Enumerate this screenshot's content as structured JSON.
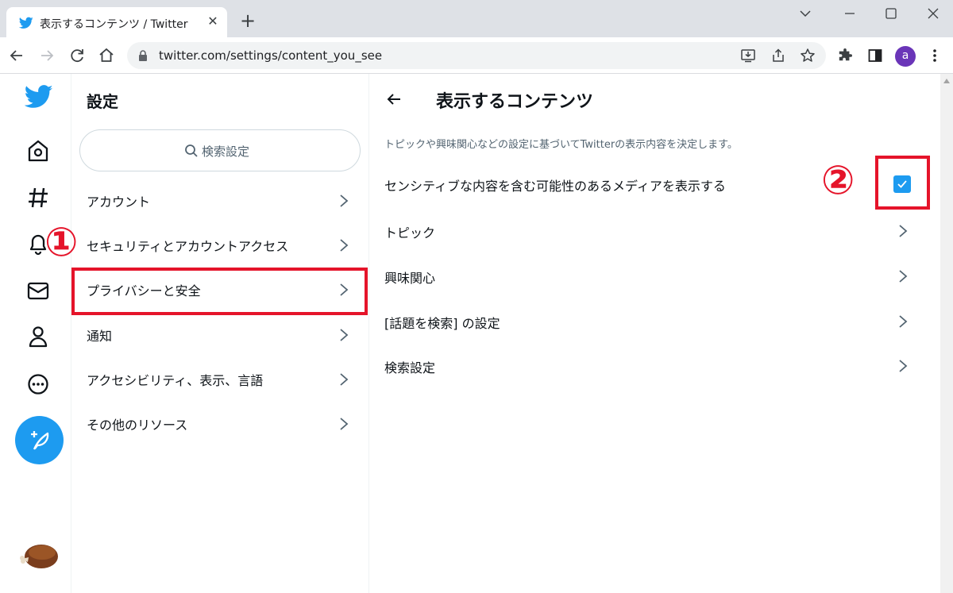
{
  "browser": {
    "tab_title": "表示するコンテンツ / Twitter",
    "tab_close": "✕",
    "new_tab": "+",
    "url": "twitter.com/settings/content_you_see",
    "profile_initial": "a"
  },
  "settings": {
    "title": "設定",
    "search_placeholder": "検索設定",
    "menu": [
      {
        "label": "アカウント"
      },
      {
        "label": "セキュリティとアカウントアクセス"
      },
      {
        "label": "プライバシーと安全"
      },
      {
        "label": "通知"
      },
      {
        "label": "アクセシビリティ、表示、言語"
      },
      {
        "label": "その他のリソース"
      }
    ]
  },
  "content": {
    "title": "表示するコンテンツ",
    "description": "トピックや興味関心などの設定に基づいてTwitterの表示内容を決定します。",
    "sensitive_media_label": "センシティブな内容を含む可能性のあるメディアを表示する",
    "sensitive_media_checked": true,
    "rows": [
      {
        "label": "トピック"
      },
      {
        "label": "興味関心"
      },
      {
        "label": "[話題を検索] の設定"
      },
      {
        "label": "検索設定"
      }
    ]
  },
  "annotations": {
    "badge_1": "①",
    "badge_2": "②",
    "highlight_color": "#e5142a"
  },
  "colors": {
    "brand": "#1d9bf0",
    "text": "#0f1419",
    "secondary": "#536471"
  }
}
